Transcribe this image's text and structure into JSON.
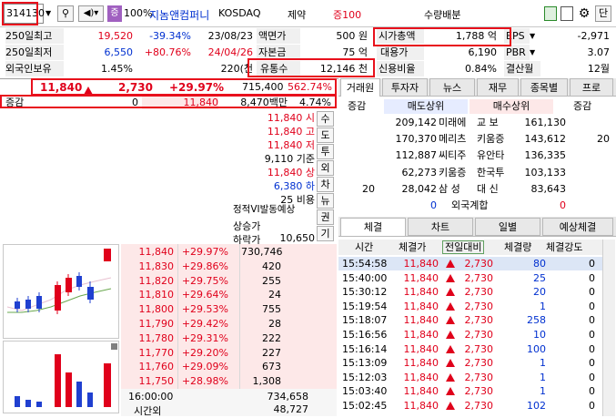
{
  "toolbar": {
    "code": "314130",
    "pct_label": "100%",
    "name": "지놈앤컴퍼니",
    "market": "KOSDAQ",
    "sector": "제약",
    "margin": "증100",
    "vol_label": "수량배분",
    "end_btn": "단"
  },
  "info": {
    "r1": {
      "l1": "250일최고",
      "v1": "19,520",
      "p1": "-39.34%",
      "d1": "23/08/23",
      "l2": "액면가",
      "v2": "500 원",
      "l3": "시가총액",
      "v3": "1,788 억",
      "l4": "EPS",
      "v4": "-2,971"
    },
    "r2": {
      "l1": "250일최저",
      "v1": "6,550",
      "p1": "+80.76%",
      "d1": "24/04/26",
      "l2": "자본금",
      "v2": "75 억",
      "l3": "대용가",
      "v3": "6,190",
      "l4": "PBR",
      "v4": "3.07"
    },
    "r3": {
      "l1": "외국인보유",
      "v1": "1.45%",
      "d1": "220(천",
      "l2": "유통수",
      "v2": "12,146 천",
      "l3": "신용비율",
      "v3": "0.84%",
      "l4": "결산월",
      "v4": "12월"
    }
  },
  "quote": {
    "price": "11,840",
    "change": "2,730",
    "rate": "+29.97%",
    "volume": "715,400",
    "vol_rate": "562.74%",
    "lbl2": "증감",
    "zero": "0",
    "price2": "11,840",
    "amount": "8,470백만",
    "turn": "4.74%"
  },
  "summary": [
    {
      "v": "11,840",
      "k": "시"
    },
    {
      "v": "11,840",
      "k": "고"
    },
    {
      "v": "11,840",
      "k": "저"
    },
    {
      "v": "9,110",
      "k": "기준"
    },
    {
      "v": "11,840",
      "k": "상"
    },
    {
      "v": "6,380",
      "k": "하"
    },
    {
      "v": "25",
      "k": "비용"
    }
  ],
  "vi": {
    "title": "정적VI발동예상",
    "l1": "상승가",
    "l2": "하락가",
    "v2": "10,650"
  },
  "side_btns": [
    "수",
    "도",
    "투",
    "외",
    "차",
    "뉴",
    "권",
    "기"
  ],
  "orderbook": [
    {
      "p": "11,840",
      "r": "+29.97%",
      "q": "730,746"
    },
    {
      "p": "11,830",
      "r": "+29.86%",
      "q": "420"
    },
    {
      "p": "11,820",
      "r": "+29.75%",
      "q": "255"
    },
    {
      "p": "11,810",
      "r": "+29.64%",
      "q": "24"
    },
    {
      "p": "11,800",
      "r": "+29.53%",
      "q": "755"
    },
    {
      "p": "11,790",
      "r": "+29.42%",
      "q": "28"
    },
    {
      "p": "11,780",
      "r": "+29.31%",
      "q": "222"
    },
    {
      "p": "11,770",
      "r": "+29.20%",
      "q": "227"
    },
    {
      "p": "11,760",
      "r": "+29.09%",
      "q": "673"
    },
    {
      "p": "11,750",
      "r": "+28.98%",
      "q": "1,308"
    }
  ],
  "ob_foot": {
    "time": "16:00:00",
    "total": "734,658",
    "after": "시간외",
    "after_v": "48,727"
  },
  "rtabs": [
    "거래원",
    "투자자",
    "뉴스",
    "재무",
    "종목별",
    "프로"
  ],
  "broker_head": {
    "c1": "증감",
    "c2": "매도상위",
    "c3": "매수상위",
    "c4": "증감"
  },
  "brokers": [
    {
      "sq": "209,142",
      "sn": "미래에",
      "bn": "교 보",
      "bq": "161,130",
      "bd": ""
    },
    {
      "sq": "170,370",
      "sn": "메리츠",
      "bn": "키움증",
      "bq": "143,612",
      "bd": "20"
    },
    {
      "sq": "112,887",
      "sn": "씨티주",
      "bn": "유안타",
      "bq": "136,335",
      "bd": ""
    },
    {
      "sq": "62,273",
      "sn": "키움증",
      "bn": "한국투",
      "bq": "103,133",
      "bd": ""
    },
    {
      "sd": "20",
      "sq": "28,042",
      "sn": "삼 성",
      "bn": "대 신",
      "bq": "83,643",
      "bd": ""
    }
  ],
  "broker_foot": {
    "v1": "0",
    "lbl": "외국계합",
    "v2": "0"
  },
  "ttabs": [
    "체결",
    "차트",
    "일별",
    "예상체결"
  ],
  "trade_head": {
    "t": "시간",
    "p": "체결가",
    "c": "전일대비",
    "q": "체결량",
    "s": "체결강도"
  },
  "trades": [
    {
      "t": "15:54:58",
      "p": "11,840",
      "c": "2,730",
      "q": "80",
      "s": "0"
    },
    {
      "t": "15:40:00",
      "p": "11,840",
      "c": "2,730",
      "q": "25",
      "s": "0"
    },
    {
      "t": "15:30:12",
      "p": "11,840",
      "c": "2,730",
      "q": "20",
      "s": "0"
    },
    {
      "t": "15:19:54",
      "p": "11,840",
      "c": "2,730",
      "q": "1",
      "s": "0"
    },
    {
      "t": "15:18:07",
      "p": "11,840",
      "c": "2,730",
      "q": "258",
      "s": "0"
    },
    {
      "t": "15:16:56",
      "p": "11,840",
      "c": "2,730",
      "q": "10",
      "s": "0"
    },
    {
      "t": "15:16:14",
      "p": "11,840",
      "c": "2,730",
      "q": "100",
      "s": "0"
    },
    {
      "t": "15:13:09",
      "p": "11,840",
      "c": "2,730",
      "q": "1",
      "s": "0"
    },
    {
      "t": "15:12:03",
      "p": "11,840",
      "c": "2,730",
      "q": "1",
      "s": "0"
    },
    {
      "t": "15:03:40",
      "p": "11,840",
      "c": "2,730",
      "q": "1",
      "s": "0"
    },
    {
      "t": "15:02:45",
      "p": "11,840",
      "c": "2,730",
      "q": "102",
      "s": "0"
    }
  ]
}
